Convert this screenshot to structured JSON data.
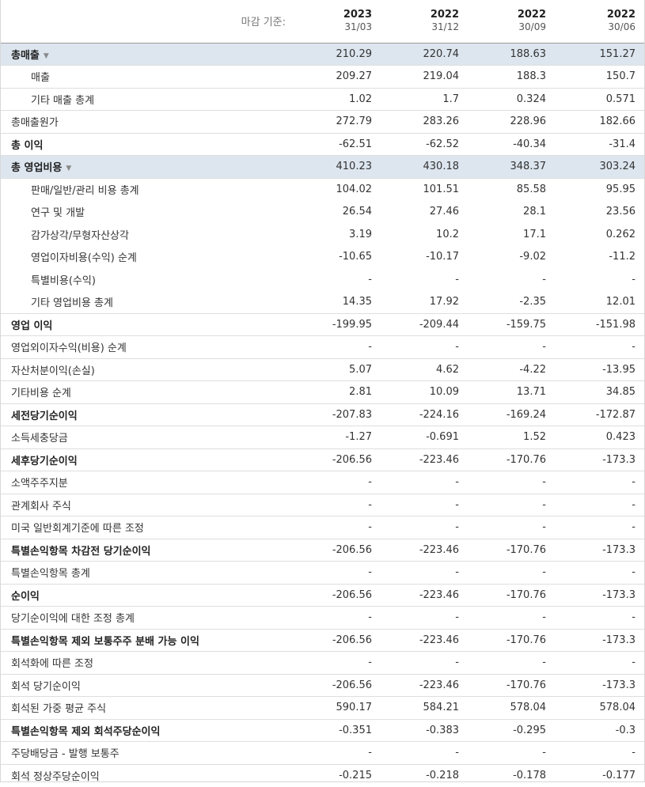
{
  "header": {
    "label": "마감 기준:",
    "columns": [
      {
        "year": "2023",
        "date": "31/03"
      },
      {
        "year": "2022",
        "date": "31/12"
      },
      {
        "year": "2022",
        "date": "30/09"
      },
      {
        "year": "2022",
        "date": "30/06"
      }
    ]
  },
  "rows": [
    {
      "label": "총매출",
      "values": [
        "210.29",
        "220.74",
        "188.63",
        "151.27"
      ]
    },
    {
      "label": "매출",
      "values": [
        "209.27",
        "219.04",
        "188.3",
        "150.7"
      ]
    },
    {
      "label": "기타 매출 총계",
      "values": [
        "1.02",
        "1.7",
        "0.324",
        "0.571"
      ]
    },
    {
      "label": "총매출원가",
      "values": [
        "272.79",
        "283.26",
        "228.96",
        "182.66"
      ]
    },
    {
      "label": "총 이익",
      "values": [
        "-62.51",
        "-62.52",
        "-40.34",
        "-31.4"
      ]
    },
    {
      "label": "총 영업비용",
      "values": [
        "410.23",
        "430.18",
        "348.37",
        "303.24"
      ]
    },
    {
      "label": "판매/일반/관리 비용 총계",
      "values": [
        "104.02",
        "101.51",
        "85.58",
        "95.95"
      ]
    },
    {
      "label": "연구 및 개발",
      "values": [
        "26.54",
        "27.46",
        "28.1",
        "23.56"
      ]
    },
    {
      "label": "감가상각/무형자산상각",
      "values": [
        "3.19",
        "10.2",
        "17.1",
        "0.262"
      ]
    },
    {
      "label": "영업이자비용(수익) 순계",
      "values": [
        "-10.65",
        "-10.17",
        "-9.02",
        "-11.2"
      ]
    },
    {
      "label": "특별비용(수익)",
      "values": [
        "-",
        "-",
        "-",
        "-"
      ]
    },
    {
      "label": "기타 영업비용 총계",
      "values": [
        "14.35",
        "17.92",
        "-2.35",
        "12.01"
      ]
    },
    {
      "label": "영업 이익",
      "values": [
        "-199.95",
        "-209.44",
        "-159.75",
        "-151.98"
      ]
    },
    {
      "label": "영업외이자수익(비용) 순계",
      "values": [
        "-",
        "-",
        "-",
        "-"
      ]
    },
    {
      "label": "자산처분이익(손실)",
      "values": [
        "5.07",
        "4.62",
        "-4.22",
        "-13.95"
      ]
    },
    {
      "label": "기타비용 순계",
      "values": [
        "2.81",
        "10.09",
        "13.71",
        "34.85"
      ]
    },
    {
      "label": "세전당기순이익",
      "values": [
        "-207.83",
        "-224.16",
        "-169.24",
        "-172.87"
      ]
    },
    {
      "label": "소득세충당금",
      "values": [
        "-1.27",
        "-0.691",
        "1.52",
        "0.423"
      ]
    },
    {
      "label": "세후당기순이익",
      "values": [
        "-206.56",
        "-223.46",
        "-170.76",
        "-173.3"
      ]
    },
    {
      "label": "소액주주지분",
      "values": [
        "-",
        "-",
        "-",
        "-"
      ]
    },
    {
      "label": "관계회사 주식",
      "values": [
        "-",
        "-",
        "-",
        "-"
      ]
    },
    {
      "label": "미국 일반회계기준에 따른 조정",
      "values": [
        "-",
        "-",
        "-",
        "-"
      ]
    },
    {
      "label": "특별손익항목 차감전 당기순이익",
      "values": [
        "-206.56",
        "-223.46",
        "-170.76",
        "-173.3"
      ]
    },
    {
      "label": "특별손익항목 총계",
      "values": [
        "-",
        "-",
        "-",
        "-"
      ]
    },
    {
      "label": "순이익",
      "values": [
        "-206.56",
        "-223.46",
        "-170.76",
        "-173.3"
      ]
    },
    {
      "label": "당기순이익에 대한 조정 총계",
      "values": [
        "-",
        "-",
        "-",
        "-"
      ]
    },
    {
      "label": "특별손익항목 제외 보통주주 분배 가능 이익",
      "values": [
        "-206.56",
        "-223.46",
        "-170.76",
        "-173.3"
      ]
    },
    {
      "label": "회석화에 따른 조정",
      "values": [
        "-",
        "-",
        "-",
        "-"
      ]
    },
    {
      "label": "회석 당기순이익",
      "values": [
        "-206.56",
        "-223.46",
        "-170.76",
        "-173.3"
      ]
    },
    {
      "label": "회석된 가중 평균 주식",
      "values": [
        "590.17",
        "584.21",
        "578.04",
        "578.04"
      ]
    },
    {
      "label": "특별손익항목 제외 회석주당순이익",
      "values": [
        "-0.351",
        "-0.383",
        "-0.295",
        "-0.3"
      ]
    },
    {
      "label": "주당배당금 - 발행 보통주",
      "values": [
        "-",
        "-",
        "-",
        "-"
      ]
    },
    {
      "label": "회석 정상주당순이익",
      "values": [
        "-0.215",
        "-0.218",
        "-0.178",
        "-0.177"
      ]
    }
  ],
  "colors": {
    "highlight_row": "#dde6ef",
    "border": "#dedede"
  },
  "icons": {
    "expand": "chevron-down-icon"
  }
}
